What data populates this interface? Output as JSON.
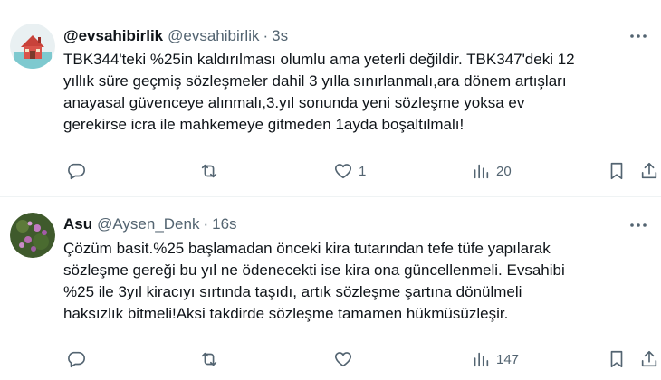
{
  "tweets": [
    {
      "display_name": "@evsahibirlik",
      "handle": "@evsahibirlik",
      "separator": "·",
      "time": "3s",
      "avatar": "house-logo-avatar",
      "text_lines": [
        "TBK344'teki %25in kaldırılması olumlu ama yeterli değildir. TBK347'deki 12",
        "yıllık süre geçmiş sözleşmeler dahil 3 yılla sınırlanmalı,ara dönem artışları",
        "anayasal güvenceye alınmalı,3.yıl sonunda yeni sözleşme yoksa ev",
        "gerekirse icra ile mahkemeye gitmeden 1ayda boşaltılmalı!"
      ],
      "reply_count": "",
      "retweet_count": "",
      "like_count": "1",
      "views_count": "20"
    },
    {
      "display_name": "Asu",
      "handle": "@Aysen_Denk",
      "separator": "·",
      "time": "16s",
      "avatar": "flower-photo-avatar",
      "text_lines": [
        "Çözüm basit.%25 başlamadan önceki kira tutarından tefe tüfe yapılarak",
        "sözleşme gereği bu yıl ne ödenecekti ise kira ona güncellenmeli. Evsahibi",
        "%25 ile 3yıl kiracıyı sırtında  taşıdı, artık sözleşme şartına dönülmeli",
        "haksızlık bitmeli!Aksi takdirde sözleşme tamamen hükmüsüzleşir."
      ],
      "reply_count": "",
      "retweet_count": "",
      "like_count": "",
      "views_count": "147"
    }
  ],
  "icons": {
    "reply": "reply-icon",
    "retweet": "retweet-icon",
    "like": "heart-icon",
    "views": "views-chart-icon",
    "bookmark": "bookmark-icon",
    "share": "share-icon",
    "more": "more-dots-icon"
  },
  "colors": {
    "text": "#0f1419",
    "secondary": "#536471",
    "divider": "#eff3f4"
  }
}
